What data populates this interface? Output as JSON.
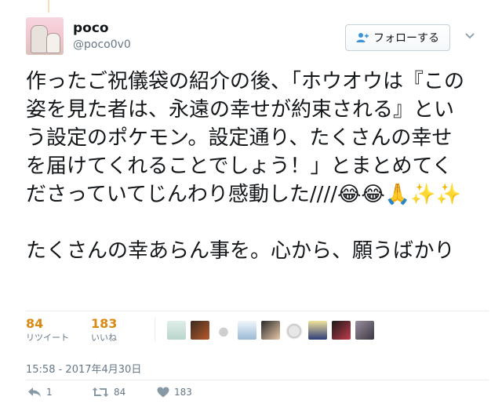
{
  "tweet": {
    "user": {
      "name": "poco",
      "handle": "@poco0v0"
    },
    "follow_label": "フォローする",
    "text": "作ったご祝儀袋の紹介の後、「ホウオウは『この姿を見た者は、永遠の幸せが約束される』という設定のポケモン。設定通り、たくさんの幸せを届けてくれることでしょう！」とまとめてくださっていてじんわり感動した////😂😂🙏✨✨\n\nたくさんの幸あらん事を。心から、願うばかり",
    "stats": {
      "retweets": {
        "count": "84",
        "label": "リツイート"
      },
      "likes": {
        "count": "183",
        "label": "いいね"
      }
    },
    "timestamp": "15:58 - 2017年4月30日",
    "actions": {
      "reply_count": "1",
      "retweet_count": "84",
      "like_count": "183"
    }
  },
  "colors": {
    "stat_number": "#d88a12",
    "muted": "#657786",
    "divider": "#e6ecf0"
  },
  "icons": {
    "follow": "person-add-icon",
    "menu": "chevron-down-icon",
    "reply": "reply-icon",
    "retweet": "retweet-icon",
    "like": "heart-icon"
  },
  "liked_by_avatars": 11
}
